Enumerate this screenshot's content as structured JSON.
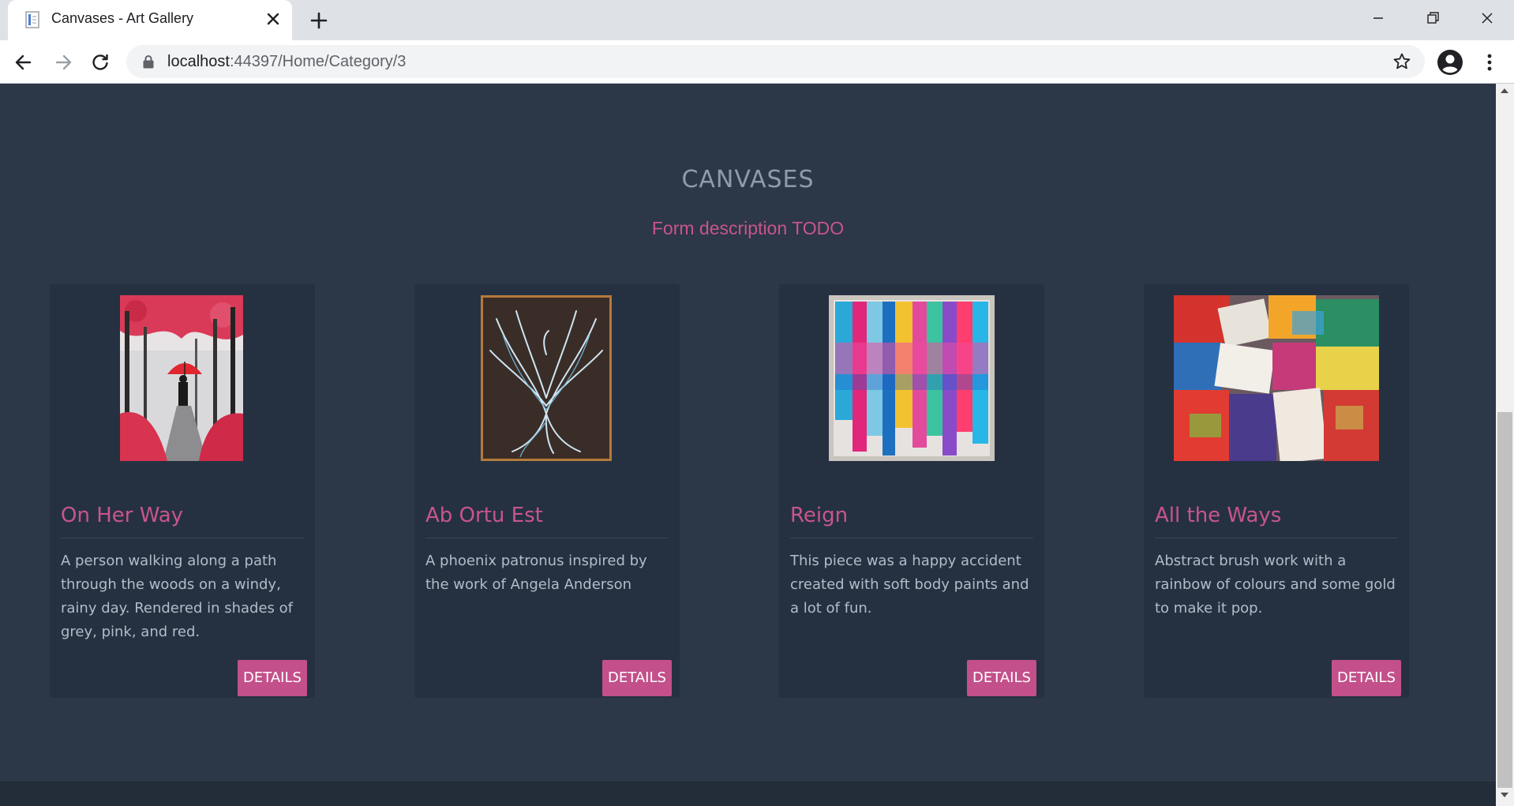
{
  "browser": {
    "tab_title": "Canvases - Art Gallery",
    "url_host": "localhost",
    "url_path": ":44397/Home/Category/3"
  },
  "page": {
    "title": "CANVASES",
    "description": "Form description TODO"
  },
  "artworks": [
    {
      "name": "On Her Way",
      "description": "A person walking along a path through the woods on a windy, rainy day. Rendered in shades of grey, pink, and red.",
      "button": "DETAILS",
      "image": "painting-woman-red-umbrella"
    },
    {
      "name": "Ab Ortu Est",
      "description": "A phoenix patronus inspired by the work of Angela Anderson",
      "button": "DETAILS",
      "image": "painting-phoenix"
    },
    {
      "name": "Reign",
      "description": "This piece was a happy accident created with soft body paints and a lot of fun.",
      "button": "DETAILS",
      "image": "painting-rainbow-drips"
    },
    {
      "name": "All the Ways",
      "description": "Abstract brush work with a rainbow of colours and some gold to make it pop.",
      "button": "DETAILS",
      "image": "painting-abstract-brushwork"
    }
  ],
  "colors": {
    "background": "#2c3747",
    "card": "#253141",
    "accent": "#c8558d",
    "button": "#c3508a",
    "title": "#8f9bab",
    "body_text": "#b3bcc8"
  }
}
